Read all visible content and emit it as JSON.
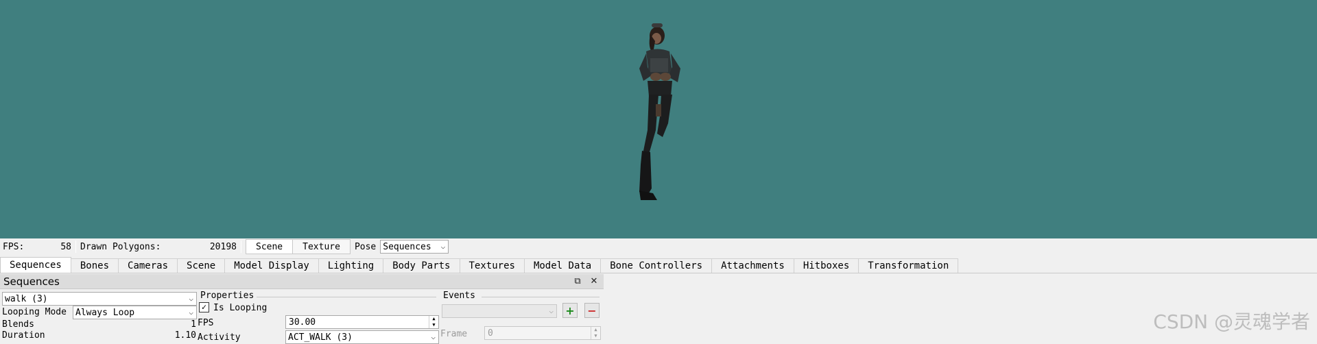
{
  "viewport": {
    "background": "#407f7f"
  },
  "stats": {
    "fps_label": "FPS:",
    "fps_value": "58",
    "polys_label": "Drawn Polygons:",
    "polys_value": "20198"
  },
  "mode_buttons": {
    "scene": "Scene",
    "texture": "Texture",
    "pose_label": "Pose",
    "pose_value": "Sequences"
  },
  "tabs": [
    "Sequences",
    "Bones",
    "Cameras",
    "Scene",
    "Model Display",
    "Lighting",
    "Body Parts",
    "Textures",
    "Model Data",
    "Bone Controllers",
    "Attachments",
    "Hitboxes",
    "Transformation"
  ],
  "panel": {
    "title": "Sequences",
    "sequence_selected": "walk (3)",
    "looping_mode_label": "Looping Mode",
    "looping_mode_value": "Always Loop",
    "blends_label": "Blends",
    "blends_value": "1",
    "duration_label": "Duration",
    "duration_value": "1.10",
    "properties": {
      "header": "Properties",
      "is_looping_label": "Is Looping",
      "is_looping_checked": "✓",
      "fps_label": "FPS",
      "fps_value": "30.00",
      "activity_label": "Activity",
      "activity_value": "ACT_WALK (3)"
    },
    "events": {
      "header": "Events",
      "add_label": "+",
      "remove_label": "−",
      "frame_label": "Frame",
      "frame_value": "0"
    }
  },
  "watermark": "CSDN @灵魂学者",
  "colors": {
    "add": "#1a8a1a",
    "remove": "#cc2a2a",
    "accent_tab": "#ffffff"
  }
}
